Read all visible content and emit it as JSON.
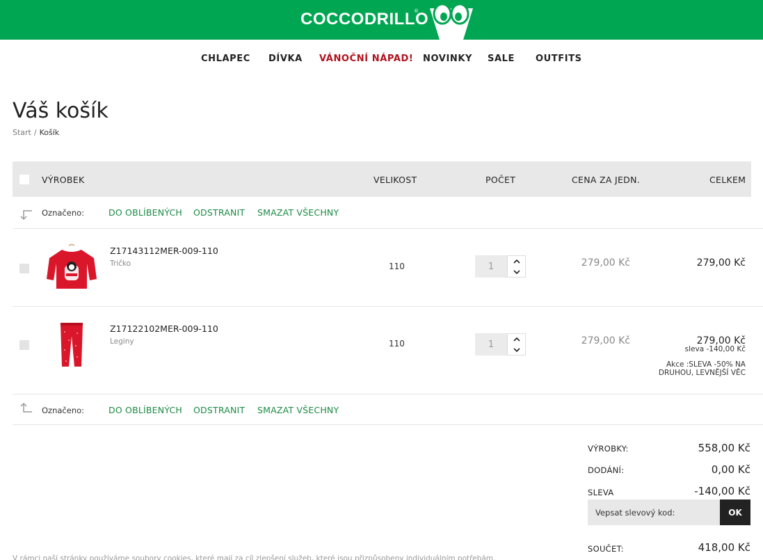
{
  "brand": {
    "name": "COCCODRILLO",
    "reg": "®",
    "color": "#00a651"
  },
  "nav": {
    "items": [
      "CHLAPEC",
      "DÍVKA",
      "VÁNOČNÍ NÁPAD!",
      "NOVINKY",
      "SALE",
      "OUTFITS"
    ]
  },
  "page": {
    "title": "Váš košík",
    "breadcrumb": [
      "Start",
      "/",
      "Košík"
    ]
  },
  "table": {
    "headers": {
      "product": "VÝROBEK",
      "size": "VELIKOST",
      "quantity": "POČET",
      "unit_price": "CENA ZA JEDN.",
      "total": "CELKEM"
    },
    "actions": {
      "label": "Označeno:",
      "favorites": "DO OBLÍBENÝCH",
      "remove": "ODSTRANIT",
      "delete_all": "SMAZAT VŠECHNY"
    },
    "items": [
      {
        "code": "Z17143112MER-009-110",
        "name": "Tričko",
        "size": "110",
        "quantity": "1",
        "unit_price": "279,00 Kč",
        "total": "279,00 Kč",
        "image": "red-long-sleeve-tshirt"
      },
      {
        "code": "Z17122102MER-009-110",
        "name": "Leginy",
        "size": "110",
        "quantity": "1",
        "unit_price": "279,00 Kč",
        "total": "279,00 Kč",
        "discount": "sleva -140,00 Kč",
        "promo": "Akce :SLEVA -50% NA DRUHOU, LEVNĚJŠÍ VĚC",
        "image": "red-leggings"
      }
    ]
  },
  "summary": {
    "products_label": "VÝROBKY:",
    "products_value": "558,00 Kč",
    "delivery_label": "DODÁNÍ:",
    "delivery_value": "0,00 Kč",
    "discount_label": "SLEVA",
    "discount_value": "-140,00 Kč",
    "coupon_placeholder": "Vepsat slevový kod:",
    "coupon_button": "OK",
    "total_label": "SOUČET:",
    "total_value": "418,00 Kč"
  },
  "cookie_text": "V rámci naší stránky používáme soubory cookies, které mají za cíl zlepšení služeb, které jsou přizpůsobeny individuálním potřebám."
}
